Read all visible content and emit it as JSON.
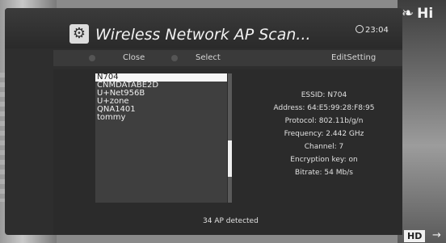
{
  "background": {
    "brand_text": "Hi",
    "hd_badge": "HD"
  },
  "window": {
    "title": "Wireless Network AP Scan...",
    "clock": "23:04"
  },
  "toolbar": {
    "close_label": "Close",
    "select_label": "Select",
    "edit_label": "EditSetting"
  },
  "ap_list": {
    "items": [
      "N704",
      "CNMDATABE2D",
      "U+Net956B",
      "U+zone",
      "QNA1401",
      "tommy"
    ],
    "selected_index": 0,
    "scroll_fraction": 0.72
  },
  "details": {
    "essid": "ESSID: N704",
    "address": "Address: 64:E5:99:28:F8:95",
    "protocol": "Protocol: 802.11b/g/n",
    "frequency": "Frequency: 2.442 GHz",
    "channel": "Channel: 7",
    "encryption": "Encryption key: on",
    "bitrate": "Bitrate: 54 Mb/s"
  },
  "status": {
    "detected": "34 AP detected"
  }
}
